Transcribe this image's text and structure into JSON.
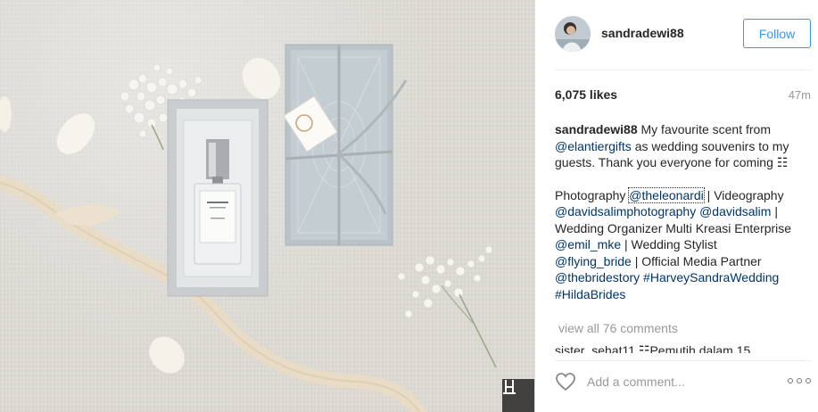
{
  "post": {
    "username": "sandradewi88",
    "follow_label": "Follow",
    "likes": "6,075 likes",
    "time_ago": "47m"
  },
  "caption": {
    "username": "sandradewi88",
    "line1_text": " My favourite scent from ",
    "mention_elantier": "@elantiergifts",
    "line2_text": " as wedding souvenirs to my guests. Thank you everyone for coming ",
    "emoji_box": "☷",
    "credits_photography": "Photography ",
    "mention_theleonardi": "@theleonardi",
    "credits_videography": " | Videography ",
    "mention_davidsalimphotography": "@davidsalimphotography",
    "mention_davidsalim": "@davidsalim",
    "credits_organizer": " | Wedding Organizer Multi Kreasi Enterprise ",
    "mention_emil": "@emil_mke",
    "credits_stylist": " | Wedding Stylist ",
    "mention_flying": "@flying_bride",
    "credits_media": " | Official Media Partner ",
    "mention_thebridestory": "@thebridestory",
    "hashtag_harvey": "#HarveySandraWedding",
    "hashtag_hilda": "#HildaBrides"
  },
  "comments": {
    "view_all": "view all 76 comments",
    "partial_comment": "sister_sehat11 ☷Pemutih dalam 15"
  },
  "add_comment": {
    "placeholder": "Add a comment..."
  },
  "colors": {
    "link": "#003569",
    "follow_blue": "#3897f0",
    "muted": "#999999"
  }
}
